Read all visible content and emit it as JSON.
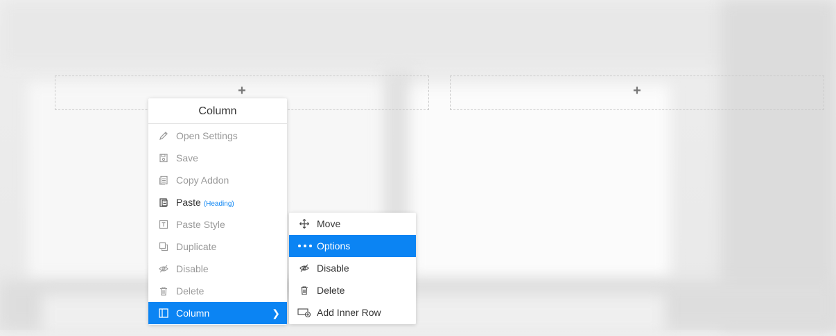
{
  "context_menu": {
    "title": "Column",
    "items": [
      {
        "label": "Open Settings",
        "icon": "pencil-icon",
        "enabled": false
      },
      {
        "label": "Save",
        "icon": "save-icon",
        "enabled": false
      },
      {
        "label": "Copy Addon",
        "icon": "copy-icon",
        "enabled": false
      },
      {
        "label": "Paste",
        "sub": "(Heading)",
        "icon": "paste-icon",
        "enabled": true
      },
      {
        "label": "Paste Style",
        "icon": "paste-style-icon",
        "enabled": false
      },
      {
        "label": "Duplicate",
        "icon": "duplicate-icon",
        "enabled": false
      },
      {
        "label": "Disable",
        "icon": "eye-slash-icon",
        "enabled": false
      },
      {
        "label": "Delete",
        "icon": "trash-icon",
        "enabled": false
      },
      {
        "label": "Column",
        "icon": "column-icon",
        "enabled": true,
        "active": true,
        "has_submenu": true
      }
    ]
  },
  "submenu": {
    "items": [
      {
        "label": "Move",
        "icon": "move-icon"
      },
      {
        "label": "Options",
        "icon": "dots-icon",
        "active": true
      },
      {
        "label": "Disable",
        "icon": "eye-slash-icon"
      },
      {
        "label": "Delete",
        "icon": "trash-icon"
      },
      {
        "label": "Add Inner Row",
        "icon": "add-row-icon"
      }
    ]
  },
  "colors": {
    "accent": "#0b84f3",
    "disabled_text": "#999999",
    "text": "#333333"
  }
}
